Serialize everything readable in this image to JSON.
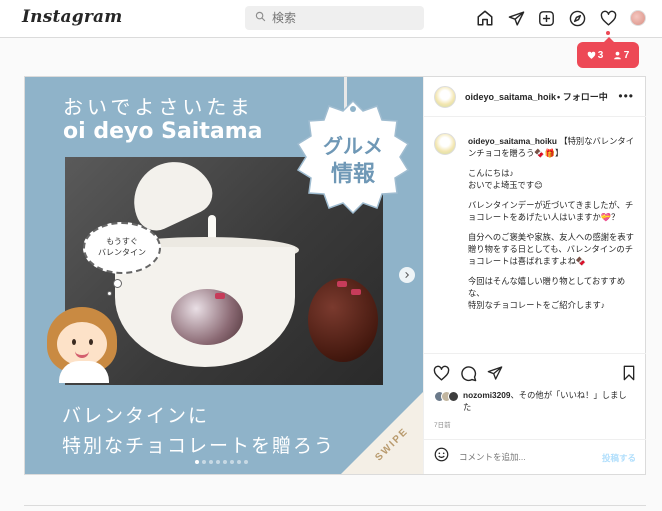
{
  "brand": {
    "logo_text": "Instagram"
  },
  "search": {
    "placeholder": "検索"
  },
  "nav": {
    "icons": [
      "home-icon",
      "direct-icon",
      "new-post-icon",
      "explore-icon",
      "activity-heart-icon",
      "profile-avatar"
    ]
  },
  "notifications": {
    "likes": "3",
    "follows": "7",
    "color": "#ed4956"
  },
  "post": {
    "media": {
      "title_jp": "おいでよさいたま",
      "title_en": "oi deyo Saitama",
      "badge_line1": "グルメ",
      "badge_line2": "情報",
      "bubble_line1": "もうすぐ",
      "bubble_line2": "バレンタイン",
      "bottom_line1": "バレンタインに",
      "bottom_line2": "特別なチョコレートを贈ろう",
      "swipe": "SWIPE",
      "slide_count": 8,
      "active_slide": 1
    },
    "header": {
      "username": "oideyo_saitama_hoik",
      "follow": "• フォロー中"
    },
    "caption": {
      "username": "oideyo_saitama_hoiku",
      "first_line": "【特別なバレンタインチョコを贈ろう🍫🎁】",
      "paragraphs": [
        "こんにちは♪\nおいでよ埼玉です😊",
        "バレンタインデーが近づいてきましたが、チョコレートをあげたい人はいますか💝？",
        "自分へのご褒美や家族、友人への感謝を表す贈り物をする日としても、バレンタインのチョコレートは喜ばれますよね🍫",
        "今回はそんな嬉しい贈り物としておすすめな、\n特別なチョコレートをご紹介します♪"
      ]
    },
    "likes": {
      "user": "nozomi3209",
      "text": "、その他が「いいね！」しました"
    },
    "time": "7日前",
    "comment": {
      "placeholder": "コメントを追加...",
      "post_label": "投稿する"
    }
  }
}
